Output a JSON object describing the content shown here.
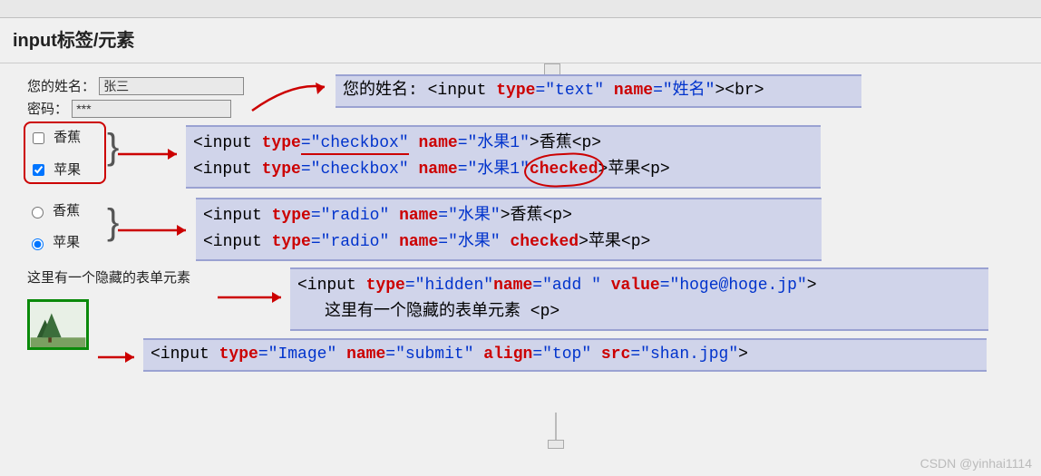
{
  "title": "input标签/元素",
  "form": {
    "name_label": "您的姓名：",
    "name_value": "张三",
    "pwd_label": "密码：",
    "pwd_value": "***",
    "cb1_label": "香蕉",
    "cb2_label": "苹果",
    "rb1_label": "香蕉",
    "rb2_label": "苹果",
    "hidden_note": "这里有一个隐藏的表单元素"
  },
  "code": {
    "text": {
      "prefix": "您的姓名: <input ",
      "type_k": "type",
      "type_v": "=\"text\"",
      "name_k": " name",
      "name_v": "=\"姓名\"",
      "suffix": "><br>"
    },
    "checkbox": {
      "l1_open": "<input ",
      "type_k": "type",
      "type_v": "=\"checkbox\"",
      "name_k": " name",
      "name_v": "=\"水果1\"",
      "l1_end": ">香蕉<p>",
      "l2_open": "<input ",
      "checked": " checked",
      "l2_end": ">苹果<p>"
    },
    "radio": {
      "l1_open": "<input ",
      "type_k": "type",
      "type_v": "=\"radio\"",
      "name_k": " name",
      "name_v": "=\"水果\"",
      "l1_end": ">香蕉<p>",
      "l2_open": "<input ",
      "checked": " checked",
      "l2_end": ">苹果<p>"
    },
    "hidden": {
      "open": "<input ",
      "type_k": "type",
      "type_v": "=\"hidden\"",
      "name_k": "name",
      "name_v": "=\"add \"",
      "value_k": " value",
      "value_v": "=\"hoge@hoge.jp\"",
      "close": ">",
      "line2": "这里有一个隐藏的表单元素 <p>"
    },
    "image": {
      "open": "<input ",
      "type_k": "type",
      "type_v": "=\"Image\"",
      "name_k": " name",
      "name_v": "=\"submit\"",
      "align_k": " align",
      "align_v": "=\"top\"",
      "src_k": " src",
      "src_v": "=\"shan.jpg\"",
      "close": ">"
    }
  },
  "watermark": "CSDN @yinhai1114"
}
